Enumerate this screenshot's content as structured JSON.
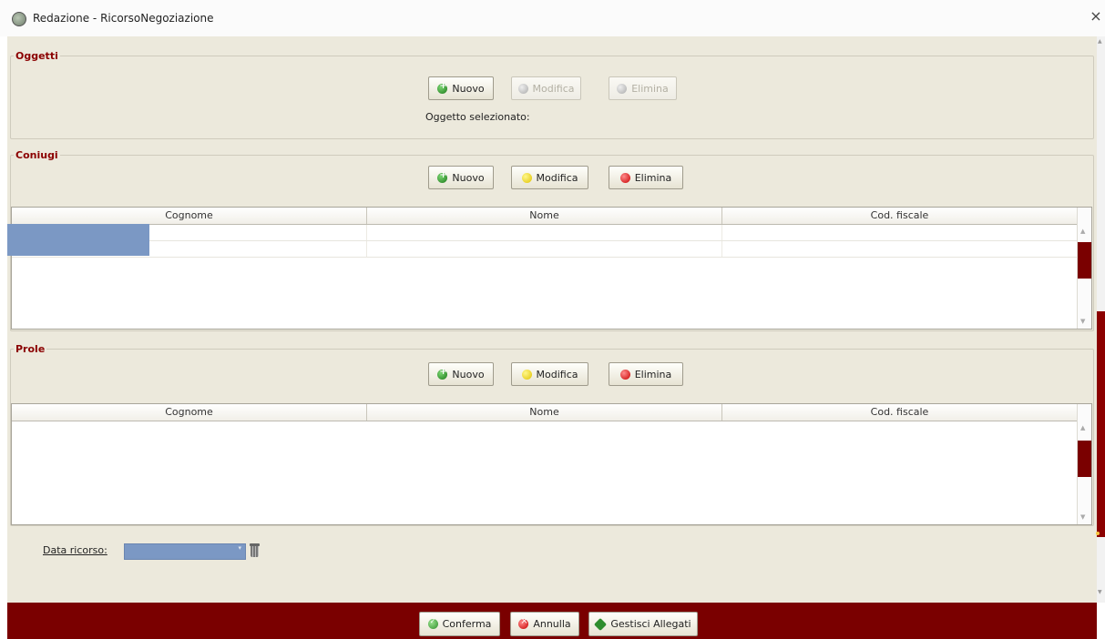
{
  "window": {
    "title": "Redazione - RicorsoNegoziazione",
    "close_glyph": "×"
  },
  "oggetti": {
    "legend": "Oggetti",
    "buttons": {
      "nuovo": "Nuovo",
      "modifica": "Modifica",
      "elimina": "Elimina"
    },
    "selected_label": "Oggetto selezionato:"
  },
  "coniugi": {
    "legend": "Coniugi",
    "buttons": {
      "nuovo": "Nuovo",
      "modifica": "Modifica",
      "elimina": "Elimina"
    },
    "columns": [
      "Cognome",
      "Nome",
      "Cod. fiscale"
    ]
  },
  "prole": {
    "legend": "Prole",
    "buttons": {
      "nuovo": "Nuovo",
      "modifica": "Modifica",
      "elimina": "Elimina"
    },
    "columns": [
      "Cognome",
      "Nome",
      "Cod. fiscale"
    ]
  },
  "data_ricorso": {
    "label": "Data ricorso:",
    "value": ""
  },
  "footer": {
    "conferma": "Conferma",
    "annulla": "Annulla",
    "allegati": "Gestisci Allegati"
  },
  "colors": {
    "accent": "#7a0000",
    "selection": "#7b98c4",
    "panel_bg": "#ece9dc"
  },
  "icons": {
    "title": "app-emblem-icon",
    "nuovo": "add-green-icon",
    "modifica": "edit-yellow-icon",
    "elimina": "delete-red-icon",
    "conferma": "check-green-icon",
    "annulla": "cancel-red-icon",
    "allegati": "attachment-icon",
    "trash": "trash-icon"
  }
}
